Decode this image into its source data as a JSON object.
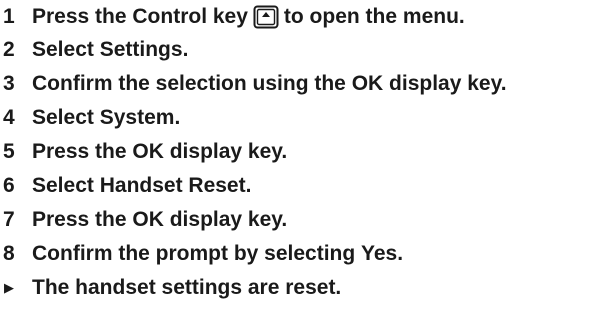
{
  "steps": [
    {
      "number": "1",
      "before": "Press the Control key",
      "after": "to open the menu.",
      "icon": "control-key-icon"
    },
    {
      "number": "2",
      "before": "Select ",
      "bold": "Settings",
      "after": "."
    },
    {
      "number": "3",
      "before": "Confirm the selection using the ",
      "bold": "OK",
      "after": " display key."
    },
    {
      "number": "4",
      "before": "Select ",
      "bold": "System",
      "after": "."
    },
    {
      "number": "5",
      "before": "Press the ",
      "bold": "OK",
      "after": " display key."
    },
    {
      "number": "6",
      "before": "Select ",
      "bold": "Handset Reset",
      "after": "."
    },
    {
      "number": "7",
      "before": "Press the ",
      "bold": "OK",
      "after": " display key."
    },
    {
      "number": "8",
      "before": "Confirm the prompt by selecting ",
      "bold": "Yes",
      "after": "."
    }
  ],
  "result": {
    "marker": "▶",
    "text": "The handset settings are reset."
  }
}
